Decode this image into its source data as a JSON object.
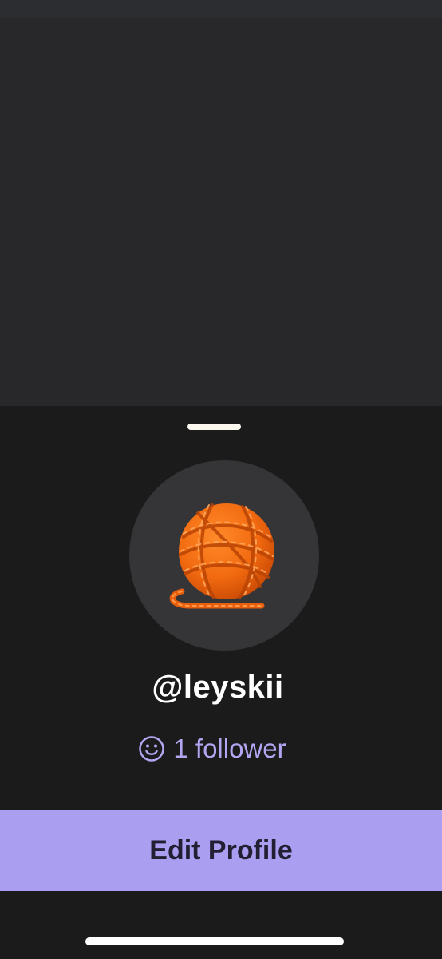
{
  "profile": {
    "username": "@leyskii",
    "followers_text": "1 follower",
    "avatar_icon": "yarn-ball-icon",
    "follower_icon": "smile-icon"
  },
  "actions": {
    "edit_profile_label": "Edit Profile"
  },
  "colors": {
    "accent": "#aa9ef0",
    "follower_text": "#b3a5f1",
    "sheet_background": "#1b1b1c",
    "backdrop": "#28282b",
    "avatar_background": "#353537",
    "yarn": "#f26a10"
  }
}
